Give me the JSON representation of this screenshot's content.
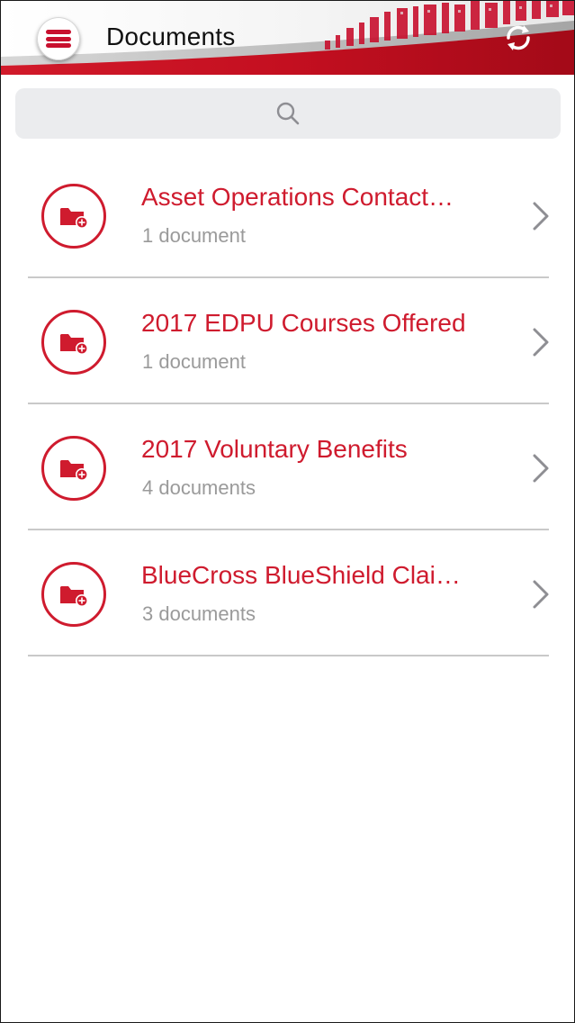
{
  "header": {
    "title": "Documents",
    "menu_icon": "hamburger-menu-icon",
    "sync_icon": "sync-icon"
  },
  "search": {
    "icon": "search-icon",
    "placeholder": ""
  },
  "colors": {
    "brand_red": "#cf1b2e",
    "secondary_text": "#9a9a9a",
    "search_bg": "#ebecee",
    "divider": "#c9c9c9"
  },
  "documents": [
    {
      "title": "Asset Operations Contact…",
      "count": "1 document",
      "icon": "folder-icon"
    },
    {
      "title": "2017 EDPU Courses Offered",
      "count": "1 document",
      "icon": "folder-icon"
    },
    {
      "title": "2017 Voluntary Benefits",
      "count": "4 documents",
      "icon": "folder-icon"
    },
    {
      "title": "BlueCross BlueShield Clai…",
      "count": "3 documents",
      "icon": "folder-icon"
    }
  ]
}
